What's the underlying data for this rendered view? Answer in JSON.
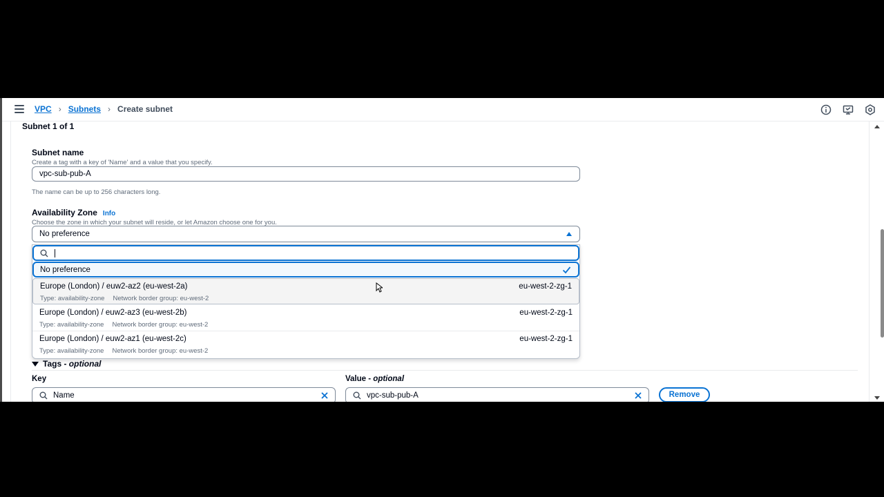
{
  "nav": {
    "breadcrumb": [
      "VPC",
      "Subnets",
      "Create subnet"
    ]
  },
  "section": {
    "title": "Subnet 1 of 1"
  },
  "subnet_name": {
    "label": "Subnet name",
    "description": "Create a tag with a key of 'Name' and a value that you specify.",
    "value": "vpc-sub-pub-A",
    "hint": "The name can be up to 256 characters long."
  },
  "availability_zone": {
    "label": "Availability Zone",
    "info": "Info",
    "description": "Choose the zone in which your subnet will reside, or let Amazon choose one for you.",
    "selected": "No preference",
    "search_value": "",
    "options": [
      {
        "label": "No preference",
        "selected": true
      },
      {
        "label": "Europe (London) / euw2-az2 (eu-west-2a)",
        "tag": "eu-west-2-zg-1",
        "type": "Type: availability-zone",
        "group": "Network border group: eu-west-2"
      },
      {
        "label": "Europe (London) / euw2-az3 (eu-west-2b)",
        "tag": "eu-west-2-zg-1",
        "type": "Type: availability-zone",
        "group": "Network border group: eu-west-2"
      },
      {
        "label": "Europe (London) / euw2-az1 (eu-west-2c)",
        "tag": "eu-west-2-zg-1",
        "type": "Type: availability-zone",
        "group": "Network border group: eu-west-2"
      }
    ]
  },
  "tags": {
    "header": "Tags",
    "header_suffix": "optional",
    "key_label": "Key",
    "value_label": "Value",
    "value_label_suffix": "optional",
    "rows": [
      {
        "key": "Name",
        "value": "vpc-sub-pub-A",
        "remove_label": "Remove"
      }
    ]
  },
  "colors": {
    "accent": "#0972d3",
    "text": "#000716",
    "muted": "#5f6b7a"
  }
}
